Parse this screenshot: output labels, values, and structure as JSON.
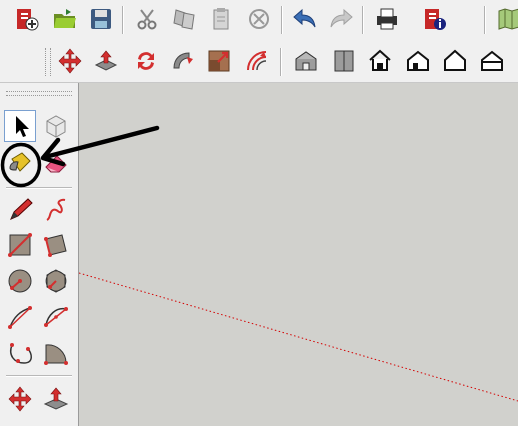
{
  "toolbar": {
    "standard": [
      "new-icon",
      "open-icon",
      "save-icon",
      "cut-icon",
      "copy-icon",
      "paste-icon",
      "erase-icon",
      "undo-icon",
      "redo-icon",
      "print-icon",
      "model-info-icon",
      "map-icon"
    ],
    "edit": [
      "move-icon",
      "push-pull-icon",
      "rotate-icon",
      "follow-me-icon",
      "scale-icon",
      "offset-icon"
    ],
    "views": [
      "iso-view-icon",
      "top-view-icon",
      "front-view-icon",
      "right-view-icon",
      "back-view-icon",
      "left-view-icon"
    ]
  },
  "palette": {
    "tools": [
      "select-icon",
      "make-component-icon",
      "paint-bucket-icon",
      "eraser-icon",
      "line-icon",
      "freehand-icon",
      "rectangle-icon",
      "rotated-rectangle-icon",
      "circle-icon",
      "polygon-icon",
      "arc-icon",
      "two-point-arc-icon",
      "three-point-arc-icon",
      "pie-icon",
      "move-icon",
      "push-pull-icon"
    ],
    "highlighted_tool": "paint-bucket-icon"
  },
  "viewport": {
    "background": "#d1d1cd",
    "axis_color": "#d40000"
  },
  "annotation": {
    "color": "#000000"
  }
}
